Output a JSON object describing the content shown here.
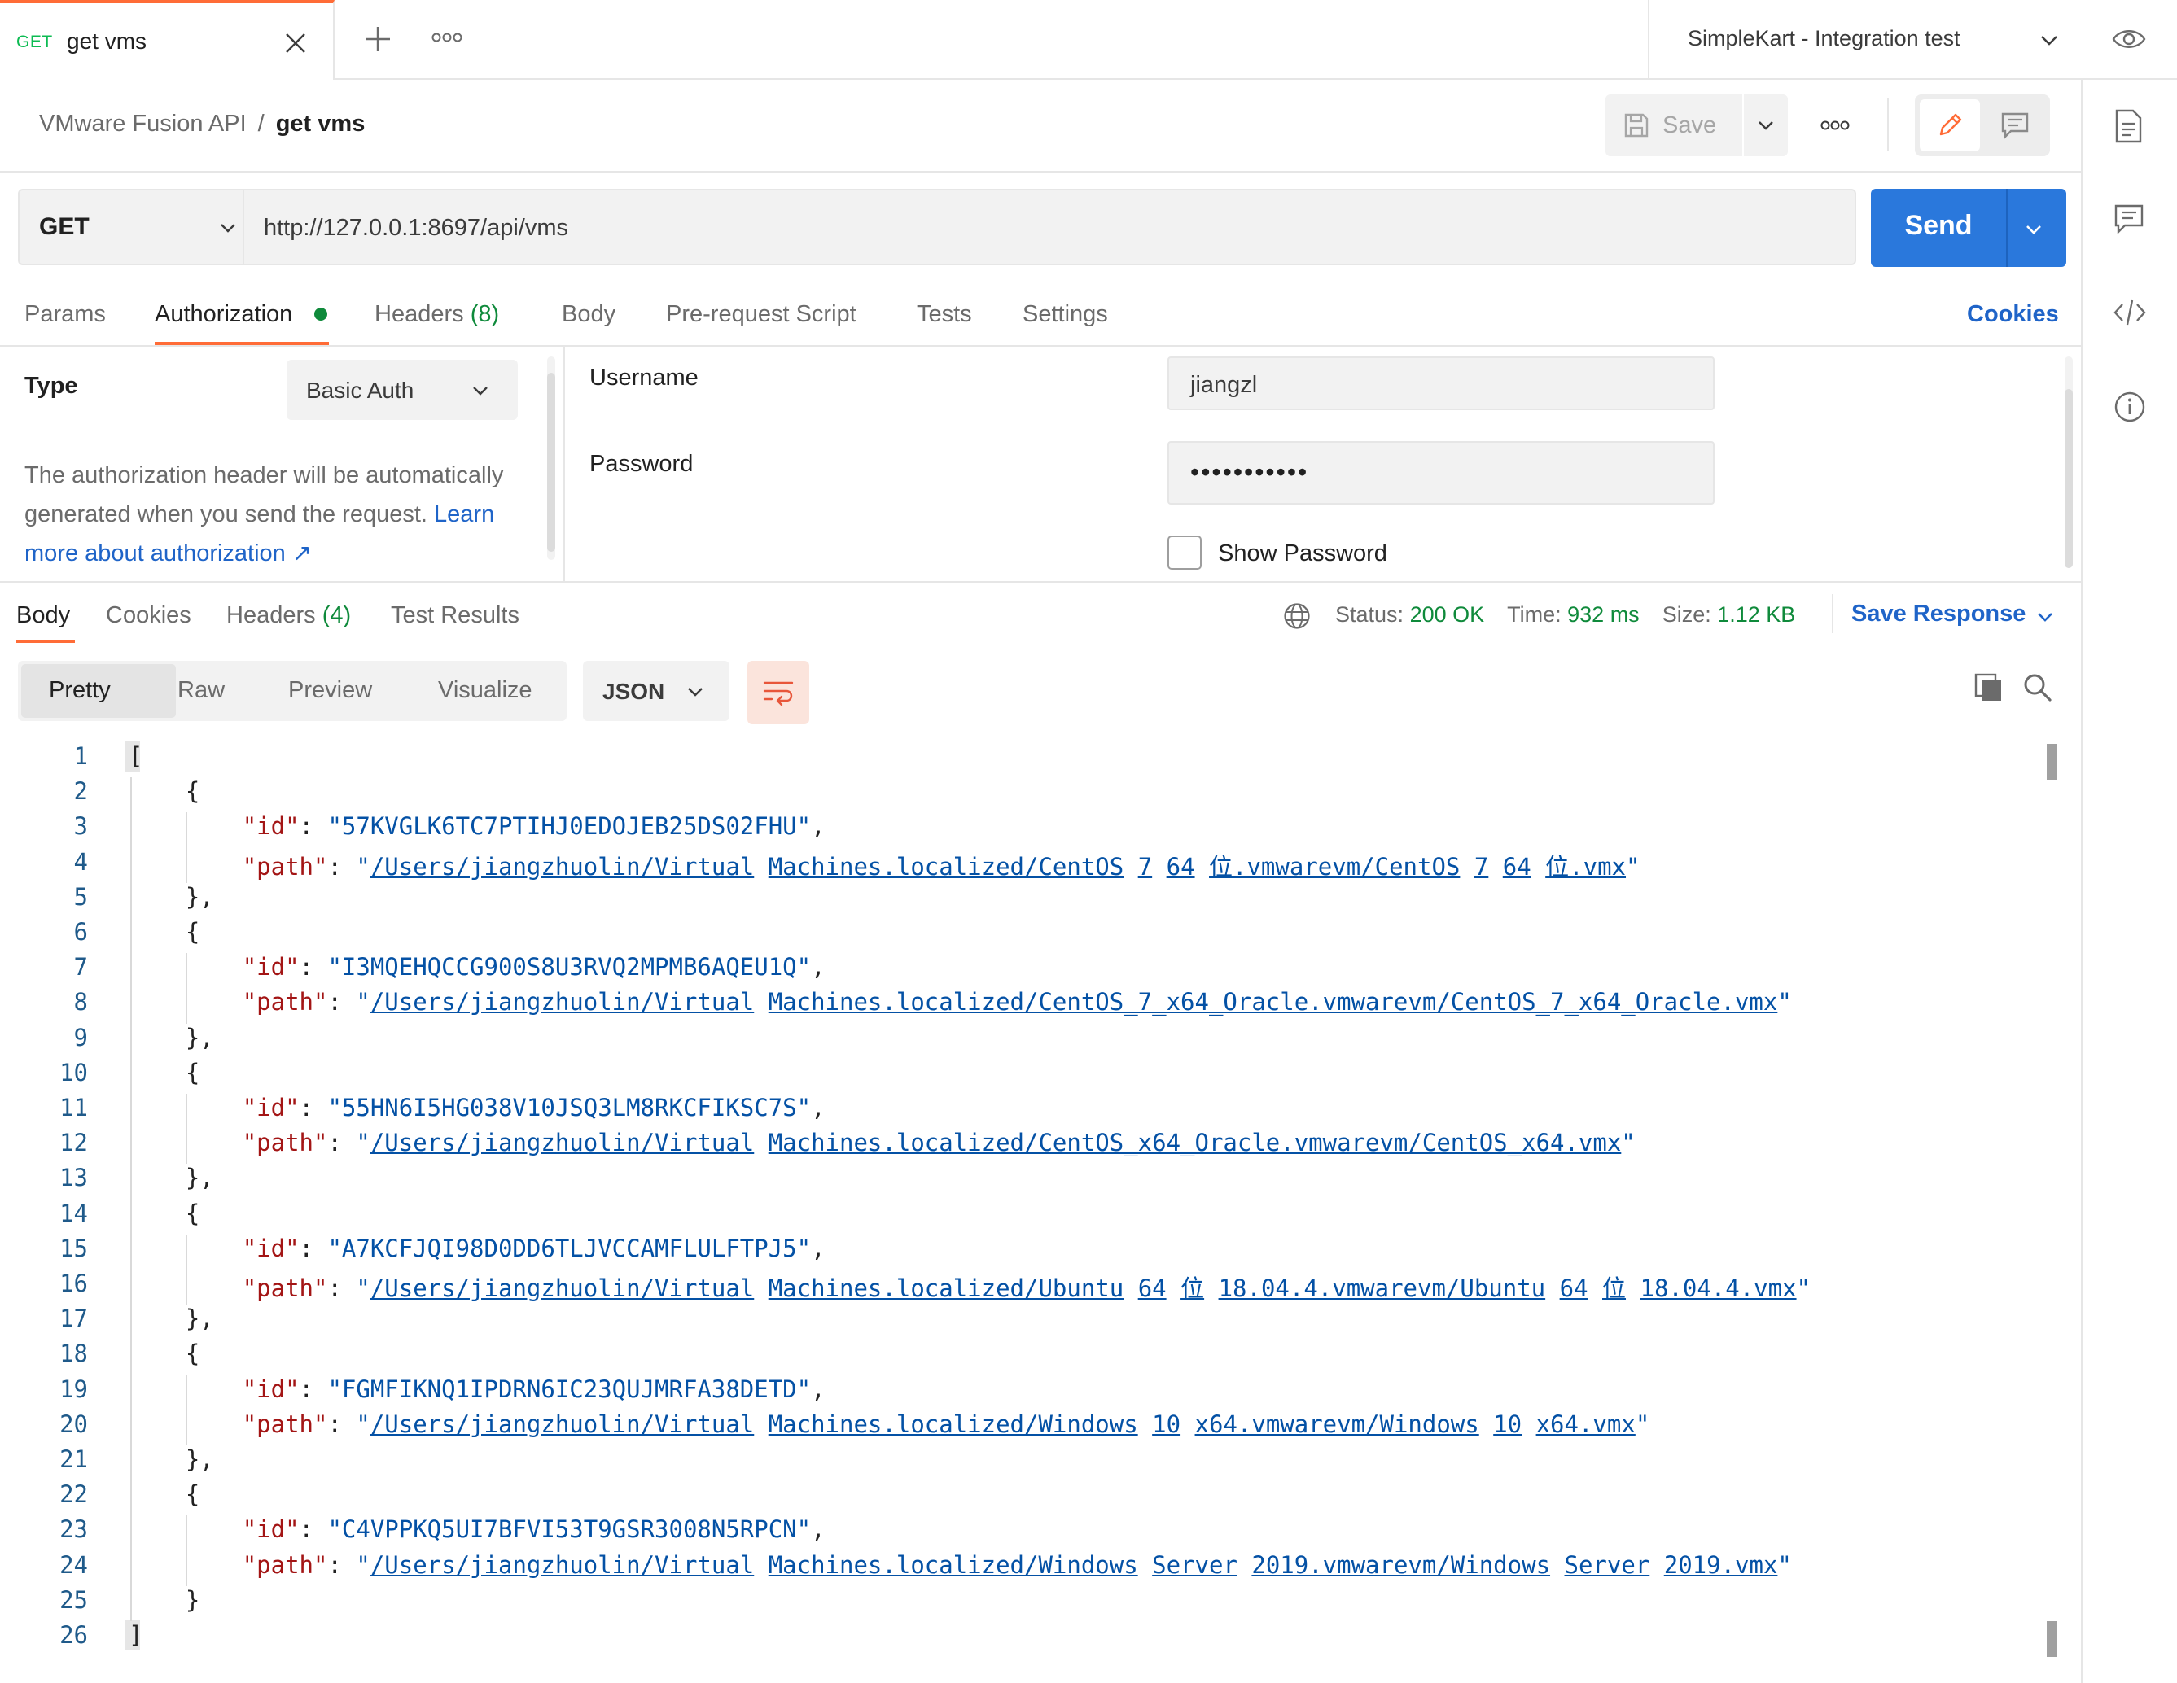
{
  "tab": {
    "method": "GET",
    "name": "get vms"
  },
  "environment": {
    "name": "SimpleKart - Integration test"
  },
  "breadcrumb": {
    "collection": "VMware Fusion API",
    "separator": "/",
    "request": "get vms"
  },
  "header": {
    "save_label": "Save"
  },
  "request": {
    "method": "GET",
    "url": "http://127.0.0.1:8697/api/vms",
    "send_label": "Send"
  },
  "request_tabs": {
    "params": "Params",
    "authorization": "Authorization",
    "headers": "Headers",
    "headers_count": "(8)",
    "body": "Body",
    "prerequest": "Pre-request Script",
    "tests": "Tests",
    "settings": "Settings",
    "cookies": "Cookies"
  },
  "auth": {
    "type_label": "Type",
    "type_value": "Basic Auth",
    "description": "The authorization header will be automatically generated when you send the request. ",
    "learn_more": "Learn more about authorization ↗",
    "username_label": "Username",
    "username_value": "jiangzl",
    "password_label": "Password",
    "password_value": "•••••••••••",
    "show_password_label": "Show Password",
    "show_password_checked": false
  },
  "response_tabs": {
    "body": "Body",
    "cookies": "Cookies",
    "headers": "Headers",
    "headers_count": "(4)",
    "test_results": "Test Results"
  },
  "response_status": {
    "status_label": "Status:",
    "status_value": "200 OK",
    "time_label": "Time:",
    "time_value": "932 ms",
    "size_label": "Size:",
    "size_value": "1.12 KB",
    "save_response": "Save Response"
  },
  "view": {
    "pretty": "Pretty",
    "raw": "Raw",
    "preview": "Preview",
    "visualize": "Visualize",
    "format": "JSON"
  },
  "colors": {
    "accent_orange": "#ff6c37",
    "send_blue": "#2a78dc",
    "link_blue": "#1f64c8",
    "success_green": "#0f8a3b",
    "json_key": "#a31515",
    "json_string": "#0451a5"
  },
  "icons": {
    "close": "close-icon",
    "plus": "plus-icon",
    "more": "more-icon",
    "chevron": "chevron-down-icon",
    "eye": "eye-icon",
    "save": "save-icon",
    "edit": "pencil-icon",
    "comment": "comment-icon",
    "document": "document-icon",
    "code": "code-icon",
    "info": "info-icon",
    "globe": "globe-icon",
    "wrap": "wrap-lines-icon",
    "copy": "copy-icon",
    "search": "search-icon"
  },
  "response_body": [
    {
      "id": "57KVGLK6TC7PTIHJ0EDOJEB25DS02FHU",
      "path": "/Users/jiangzhuolin/Virtual Machines.localized/CentOS 7 64 位.vmwarevm/CentOS 7 64 位.vmx"
    },
    {
      "id": "I3MQEHQCCG900S8U3RVQ2MPMB6AQEU1Q",
      "path": "/Users/jiangzhuolin/Virtual Machines.localized/CentOS_7_x64_Oracle.vmwarevm/CentOS_7_x64_Oracle.vmx"
    },
    {
      "id": "55HN6I5HG038V10JSQ3LM8RKCFIKSC7S",
      "path": "/Users/jiangzhuolin/Virtual Machines.localized/CentOS_x64_Oracle.vmwarevm/CentOS_x64.vmx"
    },
    {
      "id": "A7KCFJQI98D0DD6TLJVCCAMFLULFTPJ5",
      "path": "/Users/jiangzhuolin/Virtual Machines.localized/Ubuntu 64 位 18.04.4.vmwarevm/Ubuntu 64 位 18.04.4.vmx"
    },
    {
      "id": "FGMFIKNQ1IPDRN6IC23QUJMRFA38DETD",
      "path": "/Users/jiangzhuolin/Virtual Machines.localized/Windows 10 x64.vmwarevm/Windows 10 x64.vmx"
    },
    {
      "id": "C4VPPKQ5UI7BFVI53T9GSR3008N5RPCN",
      "path": "/Users/jiangzhuolin/Virtual Machines.localized/Windows Server 2019.vmwarevm/Windows Server 2019.vmx"
    }
  ]
}
